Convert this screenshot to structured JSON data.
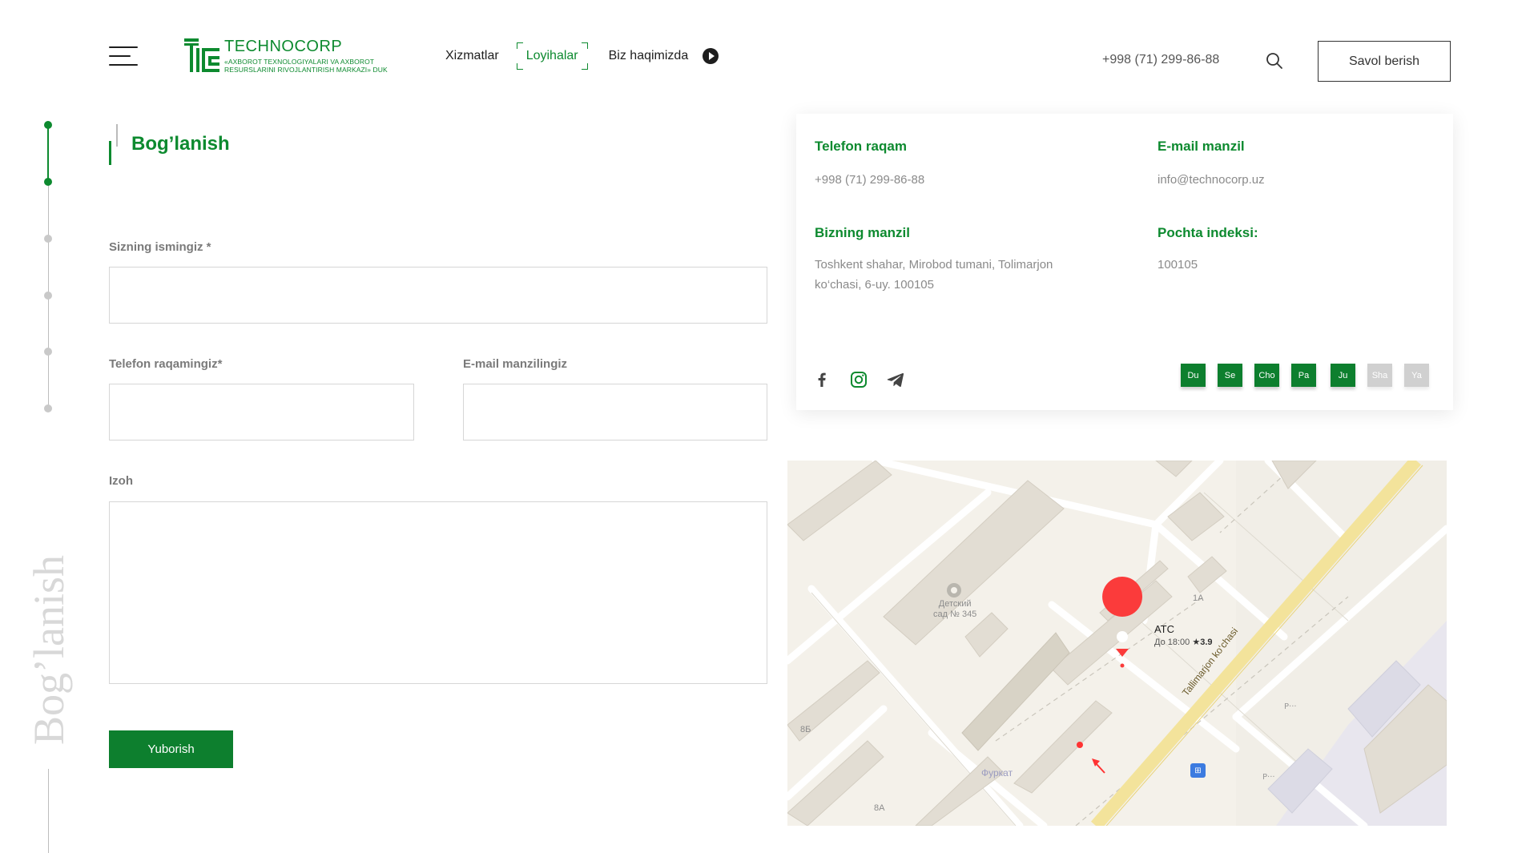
{
  "header": {
    "logo": {
      "name": "TECHNOCORP",
      "subtitle_line1": "«AXBOROT TEXNOLOGIYALARI VA AXBOROT",
      "subtitle_line2": "RESURSLARINI RIVOJLANTIRISH MARKAZI» DUK"
    },
    "nav": [
      {
        "label": "Xizmatlar",
        "active": false
      },
      {
        "label": "Loyihalar",
        "active": true
      },
      {
        "label": "Biz haqimizda",
        "active": false
      }
    ],
    "phone": "+998 (71) 299-86-88",
    "ask_button": "Savol berish"
  },
  "sidebar": {
    "vertical_title": "Bog’lanish",
    "steps": [
      {
        "active": true
      },
      {
        "active": true
      },
      {
        "active": false
      },
      {
        "active": false
      },
      {
        "active": false
      },
      {
        "active": false
      }
    ]
  },
  "form": {
    "title": "Bog’lanish",
    "name_label": "Sizning ismingiz *",
    "name_value": "",
    "phone_label": "Telefon raqamingiz*",
    "phone_value": "",
    "email_label": "E-mail manzilingiz",
    "email_value": "",
    "comment_label": "Izoh",
    "comment_value": "",
    "submit": "Yuborish"
  },
  "contact": {
    "phone_label": "Telefon raqam",
    "phone": "+998 (71) 299-86-88",
    "email_label": "E-mail manzil",
    "email": "info@technocorp.uz",
    "address_label": "Bizning manzil",
    "address_line1": "Toshkent shahar, Mirobod tumani, Tolimarjon",
    "address_line2": "ko‘chasi, 6-uy. 100105",
    "postal_label": "Pochta indeksi:",
    "postal": "100105",
    "socials": [
      "facebook-icon",
      "instagram-icon",
      "telegram-icon"
    ],
    "days": [
      {
        "label": "Du",
        "working": true
      },
      {
        "label": "Se",
        "working": true
      },
      {
        "label": "Cho",
        "working": true
      },
      {
        "label": "Pa",
        "working": true
      },
      {
        "label": "Ju",
        "working": true
      },
      {
        "label": "Sha",
        "working": false
      },
      {
        "label": "Ya",
        "working": false
      }
    ],
    "colors": {
      "working": "#0d7f2e",
      "off": "#d0d0d0",
      "accent": "#0d8a2f"
    }
  },
  "map": {
    "poi_name": "АТС",
    "poi_hours": "До 18:00",
    "poi_rating": "★3.9",
    "kindergarten_line1": "Детский",
    "kindergarten_line2": "сад № 345",
    "street": "Tallimarjon ko‘chasi",
    "house_labels": [
      "1А",
      "8Б",
      "8А"
    ],
    "area_label": "Фуркат",
    "bus_icon": "bus-stop-icon"
  }
}
